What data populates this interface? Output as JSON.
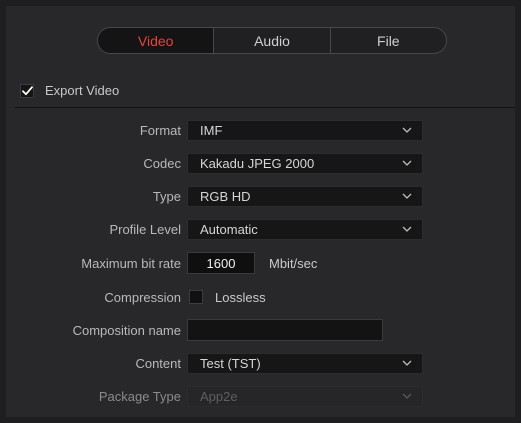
{
  "tabs": [
    {
      "label": "Video",
      "active": true
    },
    {
      "label": "Audio",
      "active": false
    },
    {
      "label": "File",
      "active": false
    }
  ],
  "export_video": {
    "label": "Export Video",
    "checked": true
  },
  "fields": {
    "format": {
      "label": "Format",
      "value": "IMF"
    },
    "codec": {
      "label": "Codec",
      "value": "Kakadu JPEG 2000"
    },
    "type": {
      "label": "Type",
      "value": "RGB HD"
    },
    "profile_level": {
      "label": "Profile Level",
      "value": "Automatic"
    },
    "max_bit_rate": {
      "label": "Maximum bit rate",
      "value": "1600",
      "unit": "Mbit/sec"
    },
    "compression": {
      "label": "Compression",
      "option_label": "Lossless",
      "checked": false
    },
    "composition_name": {
      "label": "Composition name",
      "value": ""
    },
    "content": {
      "label": "Content",
      "value": "Test (TST)"
    },
    "package_type": {
      "label": "Package Type",
      "value": "App2e",
      "disabled": true
    }
  },
  "colors": {
    "active_tab_text": "#e8443a",
    "panel_bg": "#28282b",
    "control_bg": "#161617"
  }
}
